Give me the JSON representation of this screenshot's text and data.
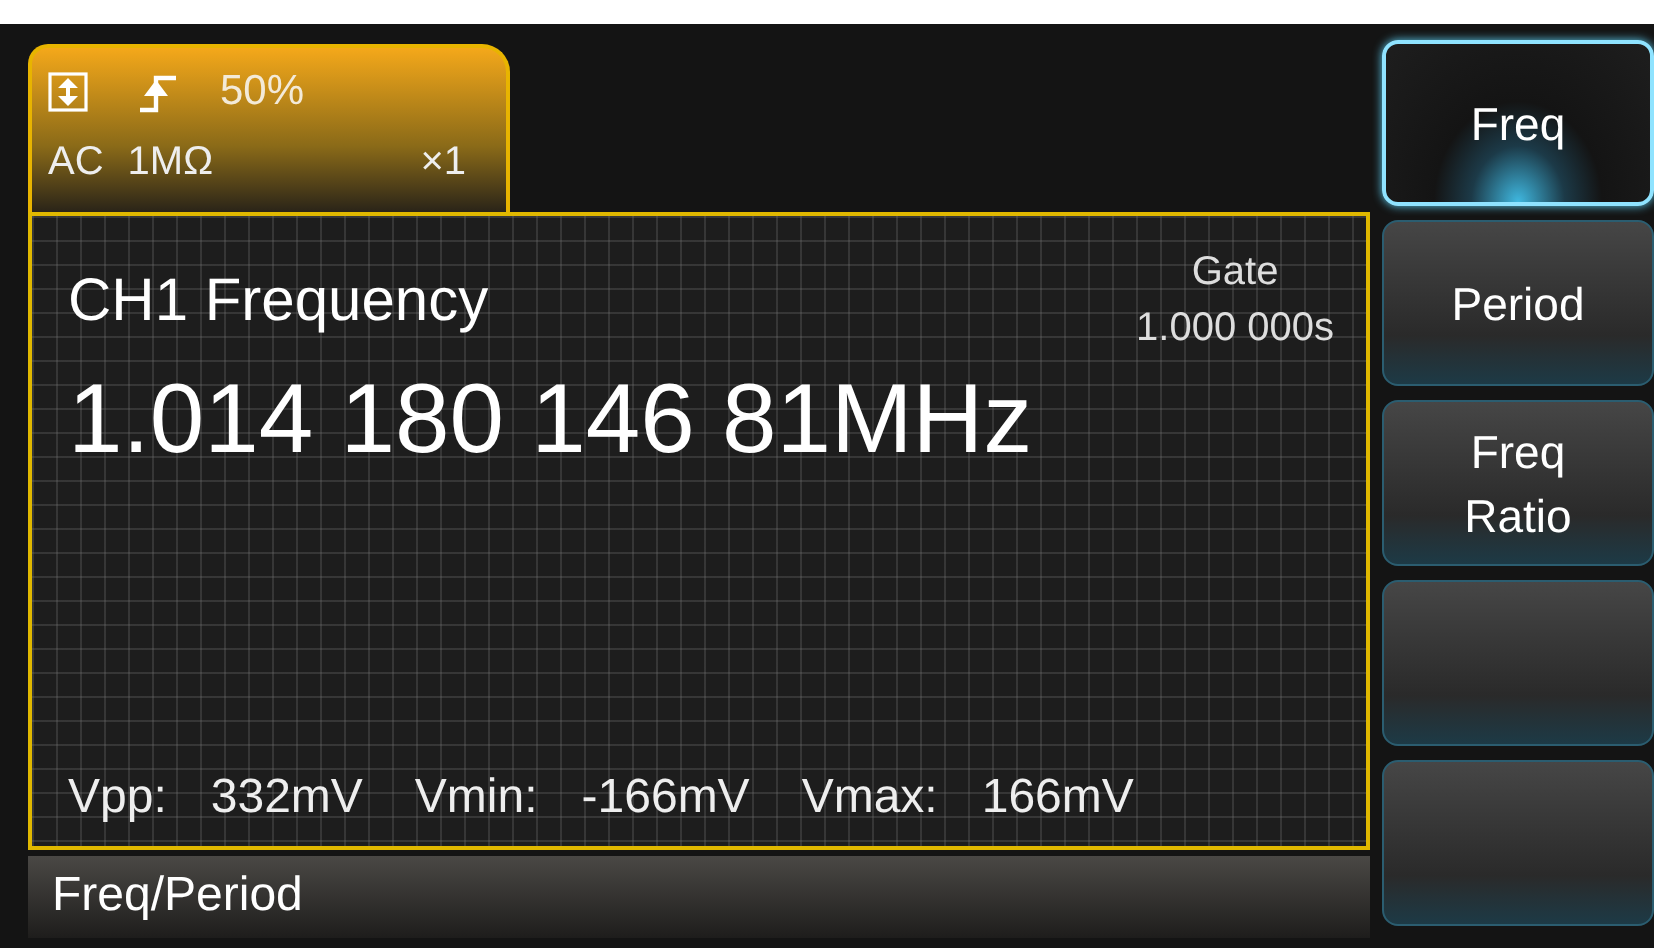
{
  "channel_tab": {
    "trigger_level": "50%",
    "coupling": "AC",
    "impedance": "1MΩ",
    "attenuation": "×1"
  },
  "measurement": {
    "title": "CH1 Frequency",
    "gate_label": "Gate",
    "gate_value": "1.000 000s",
    "reading": "1.014 180 146 81MHz",
    "stats": [
      {
        "label": "Vpp:",
        "value": "332mV"
      },
      {
        "label": "Vmin:",
        "value": "-166mV"
      },
      {
        "label": "Vmax:",
        "value": "166mV"
      }
    ]
  },
  "status_bar": {
    "text": "Freq/Period"
  },
  "softkeys": [
    {
      "lines": [
        "Freq"
      ],
      "selected": true
    },
    {
      "lines": [
        "Period"
      ],
      "selected": false
    },
    {
      "lines": [
        "Freq",
        "Ratio"
      ],
      "selected": false
    },
    {
      "selected": false
    },
    {
      "selected": false
    }
  ]
}
